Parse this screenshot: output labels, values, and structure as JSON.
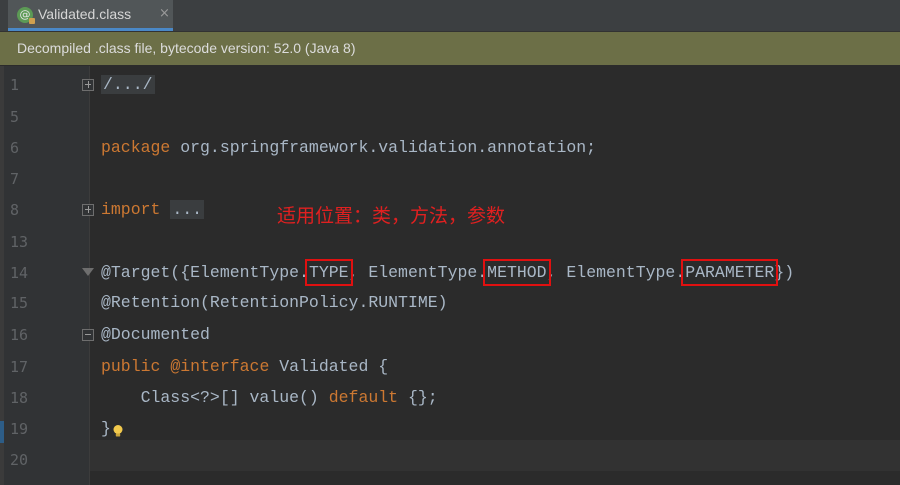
{
  "tab": {
    "title": "Validated.class",
    "icon": "class-file-icon",
    "close": "×"
  },
  "banner": {
    "text": "Decompiled .class file, bytecode version: 52.0 (Java 8)"
  },
  "annotation_note": "适用位置：类，方法，参数",
  "lines": [
    {
      "num": "1",
      "text": "/.../"
    },
    {
      "num": "5",
      "text": ""
    },
    {
      "num": "6",
      "kw": "package",
      "rest": " org.springframework.validation.annotation;"
    },
    {
      "num": "7",
      "text": ""
    },
    {
      "num": "8",
      "kw": "import",
      "folded": "..."
    },
    {
      "num": "13",
      "text": ""
    },
    {
      "num": "14",
      "prefix": "@Target({ElementType.",
      "t1": "TYPE",
      "mid1": ", ElementType.",
      "t2": "METHOD",
      "mid2": ", ElementType.",
      "t3": "PARAMETER",
      "suffix": "})"
    },
    {
      "num": "15",
      "text": "@Retention(RetentionPolicy.RUNTIME)"
    },
    {
      "num": "16",
      "text": "@Documented"
    },
    {
      "num": "17",
      "kw": "public",
      "kw2": " @interface",
      "rest": " Validated {"
    },
    {
      "num": "18",
      "pre": "    Class<?>[] value() ",
      "kw": "default",
      "rest": " {};"
    },
    {
      "num": "19",
      "text": "}"
    },
    {
      "num": "20",
      "text": ""
    }
  ],
  "colors": {
    "keyword": "#cc7832",
    "code": "#a9b7c6",
    "highlight_box": "#e01010",
    "note": "#e02020",
    "banner": "#6c6f47"
  }
}
